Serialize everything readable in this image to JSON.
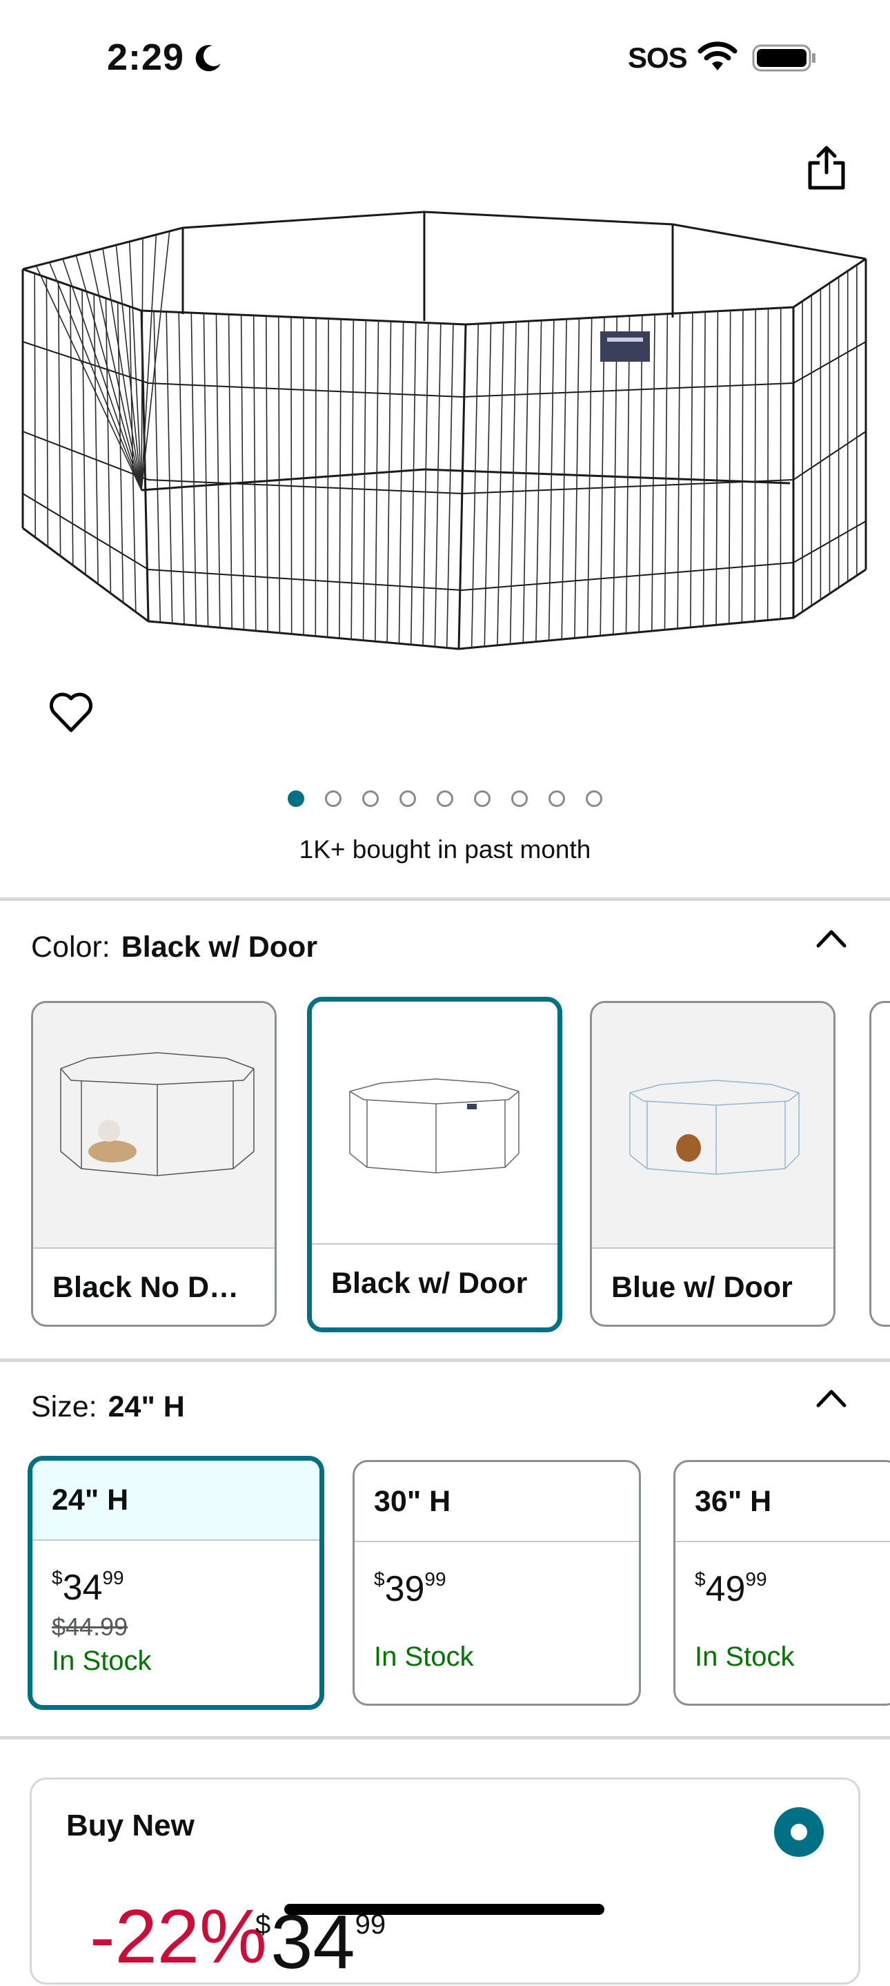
{
  "status_bar": {
    "time": "2:29",
    "sos": "SOS"
  },
  "product": {
    "bought_text": "1K+ bought in past month",
    "image_count": 9,
    "active_image": 1
  },
  "color": {
    "label": "Color:",
    "selected": "Black w/ Door",
    "options": [
      {
        "label": "Black No D…"
      },
      {
        "label": "Black w/ Door"
      },
      {
        "label": "Blue w/ Door"
      }
    ]
  },
  "size": {
    "label": "Size:",
    "selected": "24\" H",
    "options": [
      {
        "label": "24\" H",
        "currency": "$",
        "price_whole": "34",
        "price_cents": "99",
        "list_price": "$44.99",
        "stock": "In Stock"
      },
      {
        "label": "30\" H",
        "currency": "$",
        "price_whole": "39",
        "price_cents": "99",
        "stock": "In Stock"
      },
      {
        "label": "36\" H",
        "currency": "$",
        "price_whole": "49",
        "price_cents": "99",
        "stock": "In Stock"
      }
    ]
  },
  "buy_box": {
    "title": "Buy New",
    "discount": "-22%",
    "currency": "$",
    "price_whole": "34",
    "price_cents": "99"
  },
  "icons": [
    "moon-icon",
    "wifi-icon",
    "battery-icon",
    "share-icon",
    "heart-icon",
    "chevron-up-icon"
  ],
  "colors": {
    "accent": "#007185",
    "stock": "#007600",
    "discount": "#cc0c39",
    "selected_bg": "#ebfdff"
  }
}
